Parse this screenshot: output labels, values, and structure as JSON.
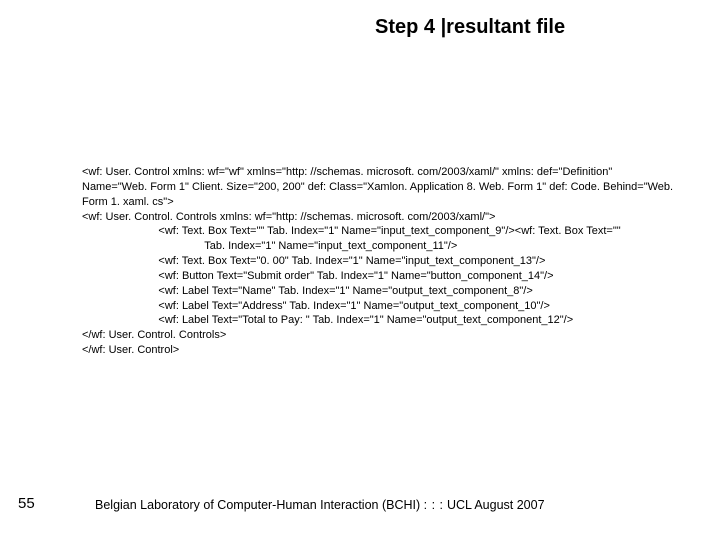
{
  "title": "Step 4 |resultant file",
  "code": "<wf: User. Control xmlns: wf=\"wf\" xmlns=\"http: //schemas. microsoft. com/2003/xaml/\" xmlns: def=\"Definition\" Name=\"Web. Form 1\" Client. Size=\"200, 200\" def: Class=\"Xamlon. Application 8. Web. Form 1\" def: Code. Behind=\"Web. Form 1. xaml. cs\">\n<wf: User. Control. Controls xmlns: wf=\"http: //schemas. microsoft. com/2003/xaml/\">\n                         <wf: Text. Box Text=\"\" Tab. Index=\"1\" Name=\"input_text_component_9\"/><wf: Text. Box Text=\"\"\n                                        Tab. Index=\"1\" Name=\"input_text_component_11\"/>\n                         <wf: Text. Box Text=\"0. 00\" Tab. Index=\"1\" Name=\"input_text_component_13\"/>\n                         <wf: Button Text=\"Submit order\" Tab. Index=\"1\" Name=\"button_component_14\"/>\n                         <wf: Label Text=\"Name\" Tab. Index=\"1\" Name=\"output_text_component_8\"/>\n                         <wf: Label Text=\"Address\" Tab. Index=\"1\" Name=\"output_text_component_10\"/>\n                         <wf: Label Text=\"Total to Pay: \" Tab. Index=\"1\" Name=\"output_text_component_12\"/>\n</wf: User. Control. Controls>\n</wf: User. Control>",
  "page_number": "55",
  "footer_main": "Belgian Laboratory of Computer-Human Interaction (BCHI)",
  "footer_sep": ": : :",
  "footer_tail": "UCL  August 2007"
}
